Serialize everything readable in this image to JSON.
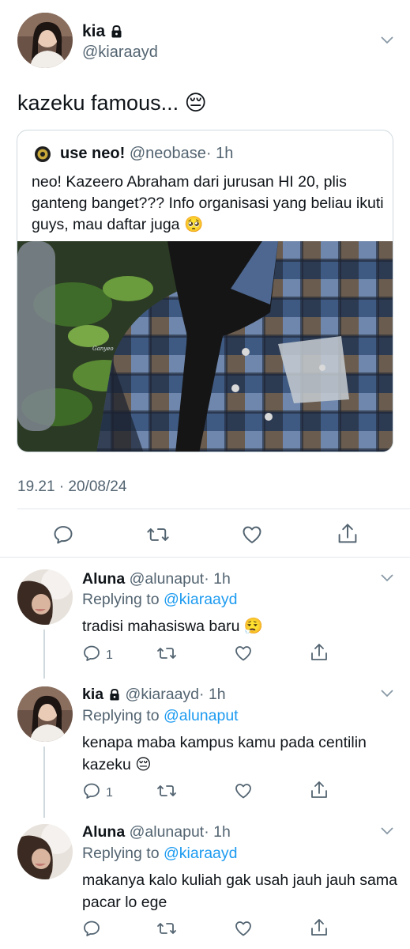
{
  "main_tweet": {
    "display_name": "kia",
    "handle": "@kiaraayd",
    "text": "kazeku famous... 😔",
    "timestamp": "19.21 · 20/08/24"
  },
  "quoted_tweet": {
    "display_name": "use neo!",
    "handle": "@neobase",
    "time": "· 1h",
    "text": "neo! Kazeero Abraham dari jurusan HI 20, plis ganteng banget??? Info organisasi yang beliau ikuti guys, mau daftar juga 🥺",
    "image_watermark": "Ganyeo"
  },
  "replies": [
    {
      "display_name": "Aluna",
      "handle": "@alunaput",
      "time": "· 1h",
      "replying_prefix": "Replying to",
      "replying_handle": "@kiaraayd",
      "text": "tradisi mahasiswa baru 😮‍💨",
      "reply_count": "1"
    },
    {
      "display_name": "kia",
      "handle": "@kiaraayd",
      "time": "· 1h",
      "replying_prefix": "Replying to",
      "replying_handle": "@alunaput",
      "text": "kenapa maba kampus kamu pada centilin kazeku 😔",
      "reply_count": "1"
    },
    {
      "display_name": "Aluna",
      "handle": "@alunaput",
      "time": "· 1h",
      "replying_prefix": "Replying to",
      "replying_handle": "@kiaraayd",
      "text": "makanya kalo kuliah gak usah jauh jauh sama pacar lo ege",
      "reply_count": ""
    }
  ],
  "icons": [
    "reply-icon",
    "retweet-icon",
    "like-icon",
    "share-icon",
    "lock-icon",
    "chevron-down-icon"
  ],
  "colors": {
    "link": "#1d9bf0",
    "muted": "#536471",
    "text": "#0f1419",
    "divider": "#e1e8ed"
  }
}
